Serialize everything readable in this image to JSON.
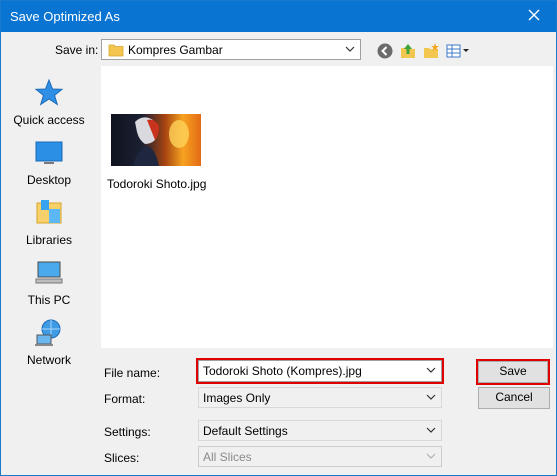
{
  "window": {
    "title": "Save Optimized As"
  },
  "save_in": {
    "label": "Save in:",
    "value": "Kompres Gambar"
  },
  "sidebar": {
    "items": [
      {
        "label": "Quick access",
        "icon": "quick-access-star-icon"
      },
      {
        "label": "Desktop",
        "icon": "desktop-icon"
      },
      {
        "label": "Libraries",
        "icon": "libraries-icon"
      },
      {
        "label": "This PC",
        "icon": "this-pc-icon"
      },
      {
        "label": "Network",
        "icon": "network-icon"
      }
    ]
  },
  "files": [
    {
      "name": "Todoroki Shoto.jpg"
    }
  ],
  "file_name": {
    "label": "File name:",
    "value": "Todoroki Shoto (Kompres).jpg"
  },
  "format": {
    "label": "Format:",
    "value": "Images Only"
  },
  "settings": {
    "label": "Settings:",
    "value": "Default Settings"
  },
  "slices": {
    "label": "Slices:",
    "value": "All Slices"
  },
  "buttons": {
    "save": "Save",
    "cancel": "Cancel"
  },
  "colors": {
    "titlebar": "#0a74d2",
    "highlight": "#e00000"
  }
}
